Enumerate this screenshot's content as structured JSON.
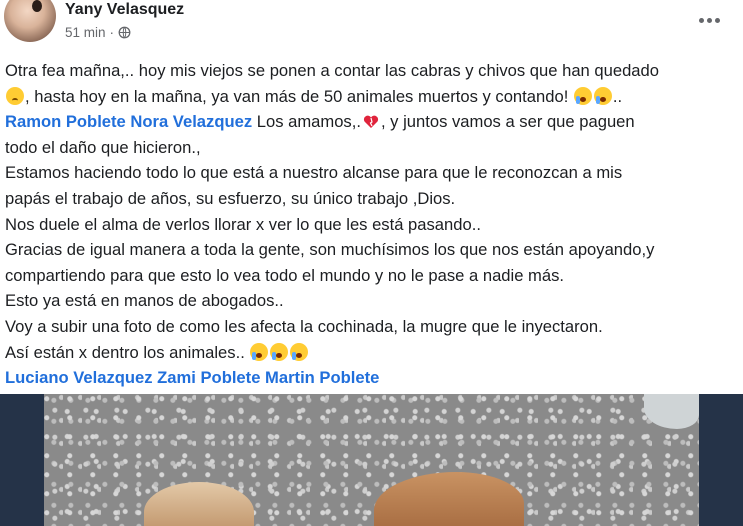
{
  "post": {
    "author": "Yany Velasquez",
    "time": "51 min",
    "separator": " · ",
    "lines": [
      {
        "parts": [
          {
            "t": "Otra fea mañna,.. hoy mis viejos se ponen a contar las cabras y chivos que han quedado"
          }
        ]
      },
      {
        "parts": [
          {
            "emoji": "sad"
          },
          {
            "t": ", hasta hoy en la mañna, ya van más de 50 animales muertos y contando! "
          },
          {
            "emoji": "cry"
          },
          {
            "emoji": "cry"
          },
          {
            "t": ".."
          }
        ]
      },
      {
        "parts": [
          {
            "mention": "Ramon Poblete Nora Velazquez"
          },
          {
            "t": " Los amamos,."
          },
          {
            "heart": true
          },
          {
            "t": ", y  juntos vamos a ser que paguen"
          }
        ]
      },
      {
        "parts": [
          {
            "t": "todo el daño que hicieron.,"
          }
        ]
      },
      {
        "parts": [
          {
            "t": "Estamos haciendo todo lo que está a nuestro alcanse para que le reconozcan a mis"
          }
        ]
      },
      {
        "parts": [
          {
            "t": "papás el trabajo de años, su esfuerzo, su único trabajo ,Dios."
          }
        ]
      },
      {
        "parts": [
          {
            "t": "Nos duele el alma de verlos llorar x ver lo que les está pasando.."
          }
        ]
      },
      {
        "parts": [
          {
            "t": "Gracias de igual manera a toda la gente, son muchísimos los que nos están apoyando,y"
          }
        ]
      },
      {
        "parts": [
          {
            "t": "compartiendo para que esto lo vea todo el mundo y no le pase a nadie más."
          }
        ]
      },
      {
        "parts": [
          {
            "t": "Esto ya está en manos de abogados.."
          }
        ]
      },
      {
        "parts": [
          {
            "t": "Voy a subir una foto de como les afecta la cochinada, la mugre que le inyectaron."
          }
        ]
      },
      {
        "parts": [
          {
            "t": "Así están x dentro los animales.. "
          },
          {
            "emoji": "cry"
          },
          {
            "emoji": "cry"
          },
          {
            "emoji": "cry"
          }
        ]
      },
      {
        "parts": [
          {
            "mention": "Luciano Velazquez Zami Poblete Martin Poblete"
          }
        ]
      }
    ]
  },
  "icons": {
    "privacy": "globe-icon",
    "options": "more-options-icon"
  },
  "colors": {
    "mention": "#216fdb",
    "meta": "#65676b",
    "photo_band": "#253348"
  }
}
